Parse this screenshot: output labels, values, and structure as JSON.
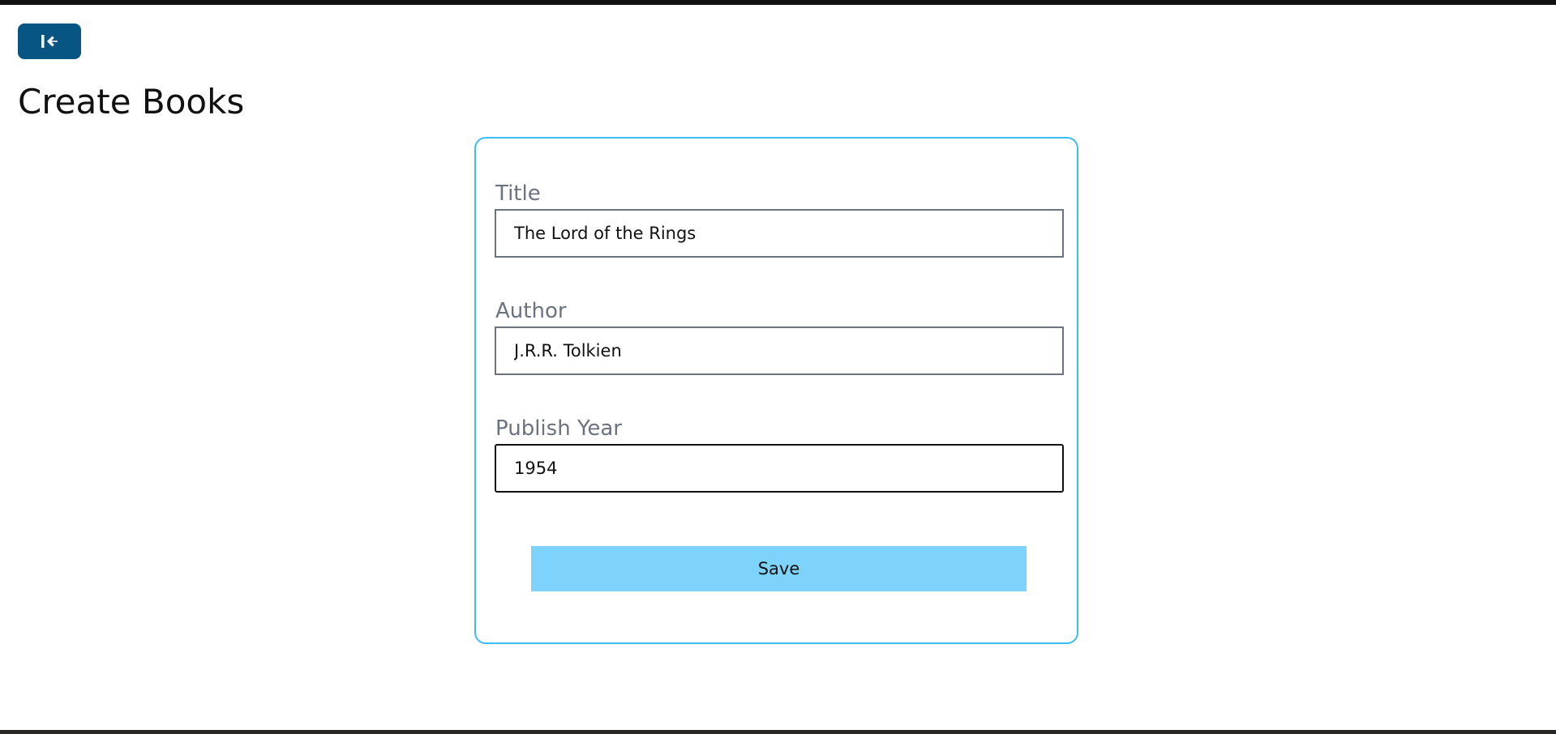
{
  "page": {
    "title": "Create Books"
  },
  "back_button": {
    "icon": "arrow-left-to-line-icon"
  },
  "form": {
    "fields": [
      {
        "label": "Title",
        "value": "The Lord of the Rings"
      },
      {
        "label": "Author",
        "value": "J.R.R. Tolkien"
      },
      {
        "label": "Publish Year",
        "value": "1954"
      }
    ],
    "save_label": "Save"
  },
  "colors": {
    "back_button": "#065582",
    "card_border": "#38bdf8",
    "save_button": "#7dd3fc",
    "label_text": "#6b7280"
  }
}
